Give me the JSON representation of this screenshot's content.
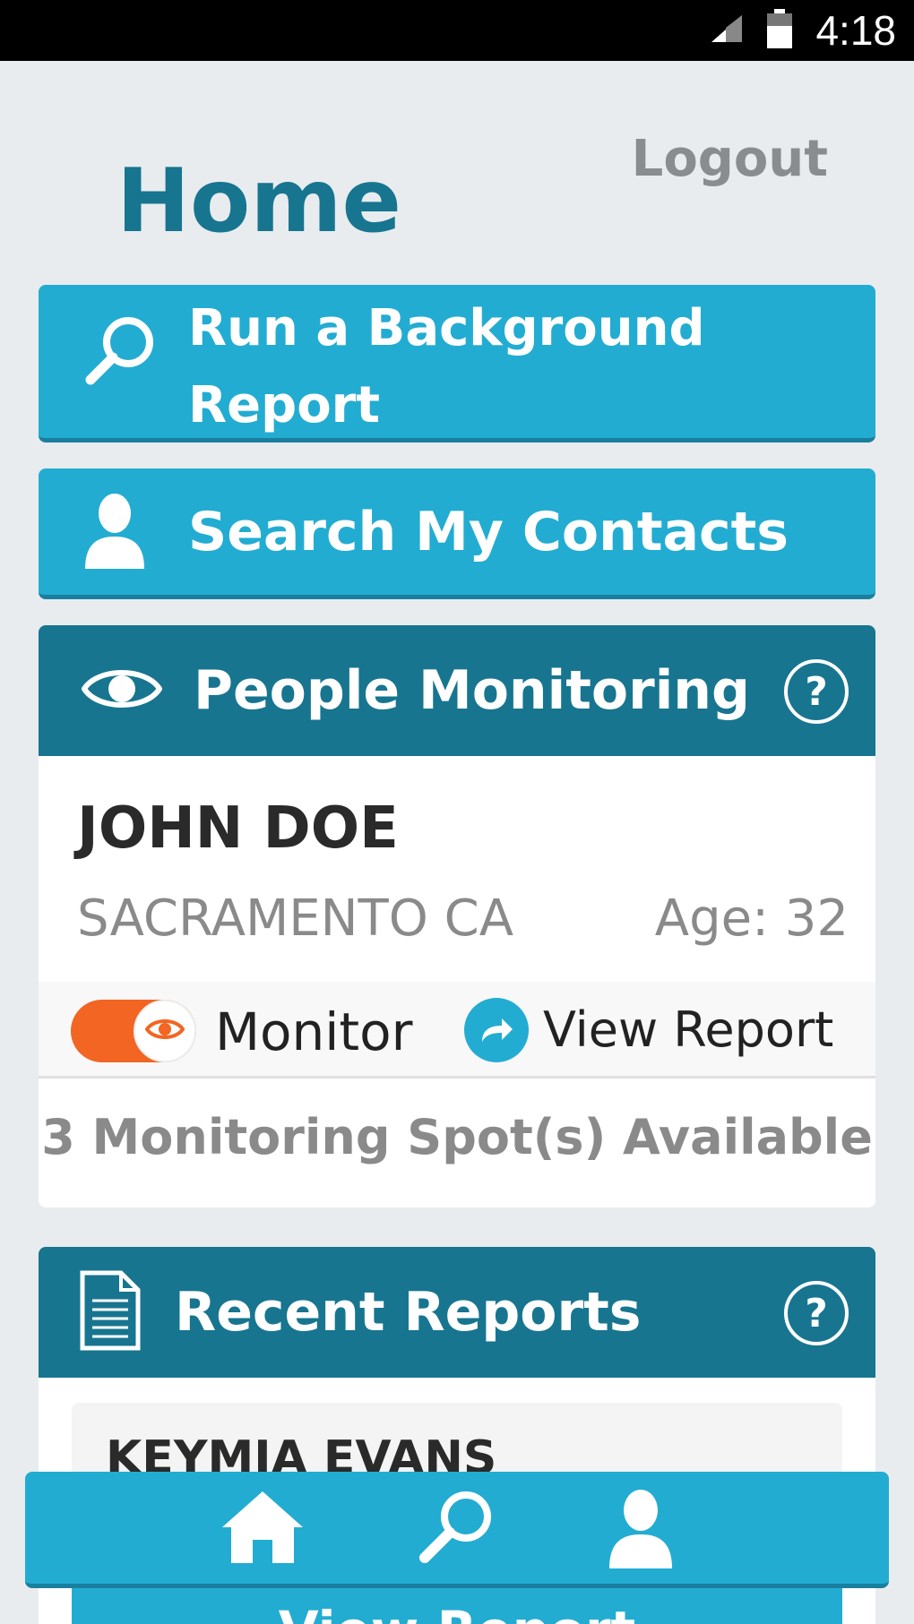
{
  "status_bar": {
    "time": "4:18",
    "icons": [
      "signal-icon",
      "battery-icon"
    ]
  },
  "header": {
    "title": "Home",
    "logout_label": "Logout"
  },
  "actions": {
    "background_report_line1": "Run a Background",
    "background_report_line2": "Report",
    "search_contacts": "Search My Contacts"
  },
  "monitoring": {
    "title": "People Monitoring",
    "help_label": "?",
    "person": {
      "name": "JOHN DOE",
      "location": "SACRAMENTO CA",
      "age": "Age: 32"
    },
    "monitor_label": "Monitor",
    "monitor_enabled": true,
    "view_report_label": "View Report",
    "spots_available": "3 Monitoring Spot(s) Available"
  },
  "recent_reports": {
    "title": "Recent Reports",
    "help_label": "?",
    "items": [
      {
        "name": "KEYMIA EVANS",
        "view_label": "View Report"
      }
    ]
  },
  "bottom_nav": {
    "items": [
      "home-icon",
      "search-icon",
      "user-icon"
    ]
  },
  "colors": {
    "accent": "#23acd2",
    "dark_header": "#177590",
    "toggle_on": "#f26522",
    "background": "#e8ecee"
  }
}
